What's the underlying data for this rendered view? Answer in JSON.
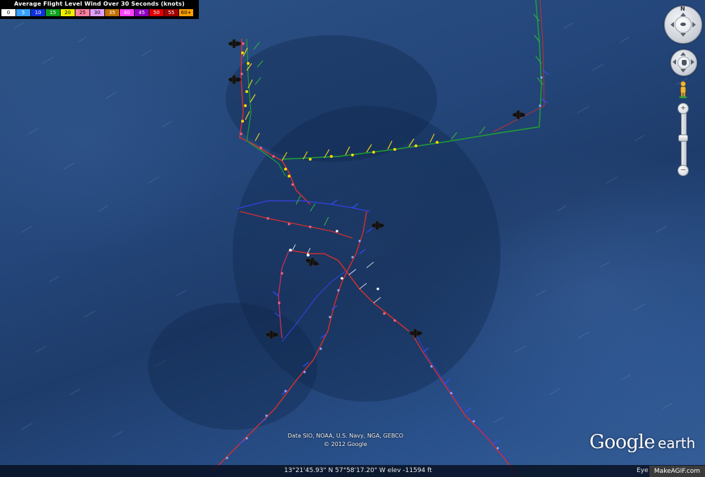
{
  "legend": {
    "title": "Average Flight Level Wind Over 30 Seconds (knots)",
    "scale": [
      {
        "label": "0",
        "color": "#ffffff",
        "text": "#000000"
      },
      {
        "label": "5",
        "color": "#39a0ff",
        "text": "#ffffff"
      },
      {
        "label": "10",
        "color": "#1030e0",
        "text": "#ffffff"
      },
      {
        "label": "15",
        "color": "#10a020",
        "text": "#ffffff"
      },
      {
        "label": "20",
        "color": "#f0f000",
        "text": "#000000"
      },
      {
        "label": "25",
        "color": "#ff80a0",
        "text": "#000000"
      },
      {
        "label": "30",
        "color": "#e0a0ff",
        "text": "#000000"
      },
      {
        "label": "35",
        "color": "#c07000",
        "text": "#ffffff"
      },
      {
        "label": "40",
        "color": "#ff40ff",
        "text": "#ffffff"
      },
      {
        "label": "45",
        "color": "#9000c0",
        "text": "#ffffff"
      },
      {
        "label": "50",
        "color": "#e00000",
        "text": "#ffffff"
      },
      {
        "label": "55",
        "color": "#a00000",
        "text": "#ffffff"
      },
      {
        "label": "60+",
        "color": "#ffa000",
        "text": "#000000"
      }
    ]
  },
  "navigation": {
    "north_label": "N",
    "zoom_in_label": "+",
    "zoom_out_label": "−"
  },
  "credits": {
    "line1": "Data SIO, NOAA, U.S. Navy, NGA, GEBCO",
    "line2": "© 2012 Google"
  },
  "logo": {
    "google": "Google",
    "earth": "earth"
  },
  "status": {
    "coordinates": "13°21'45.93\" N  57°58'17.20\" W  elev -11594 ft",
    "eye_alt": "Eye"
  },
  "watermark": "MakeAGIF.com"
}
